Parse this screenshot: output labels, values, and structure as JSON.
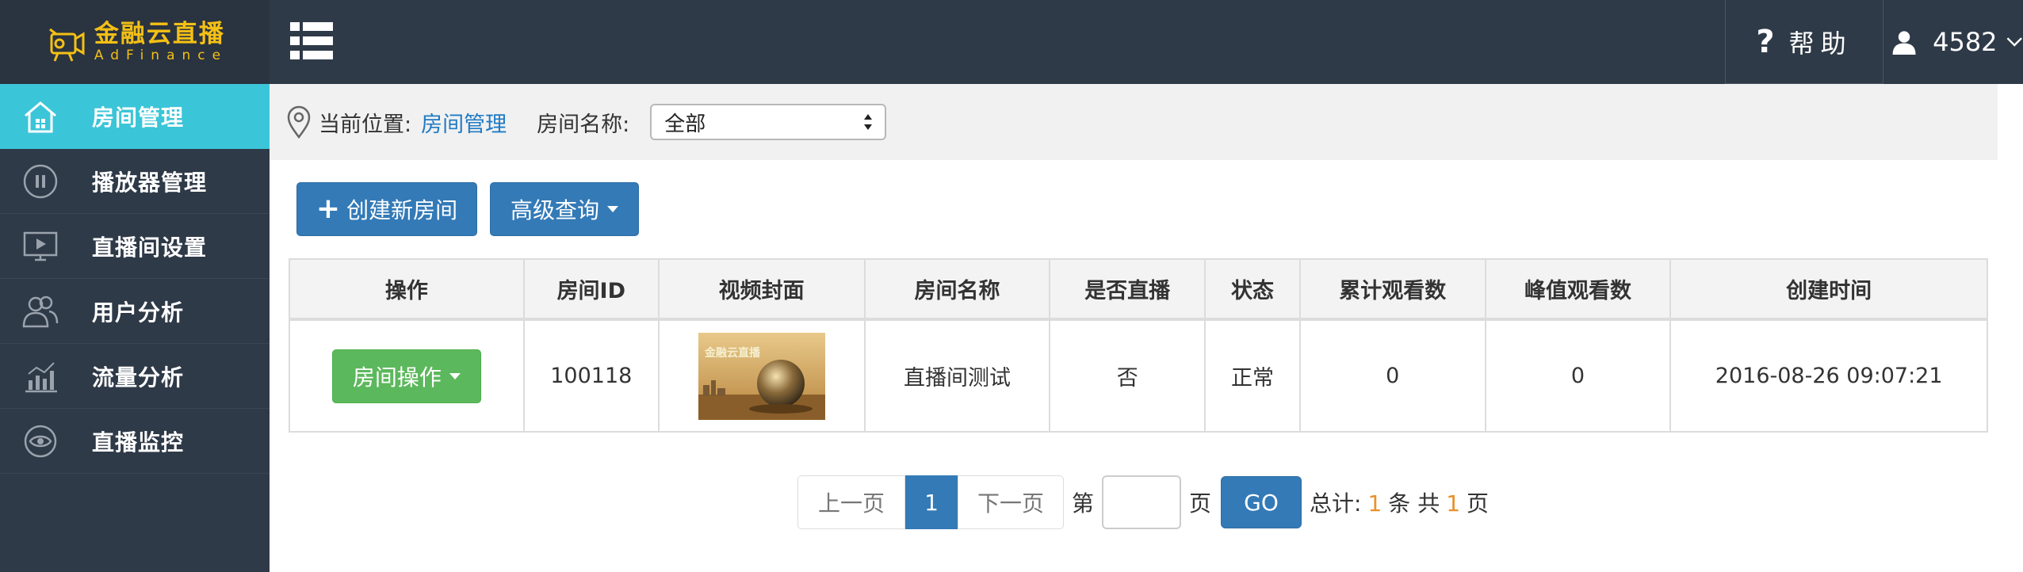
{
  "header": {
    "logo_cn": "金融云直播",
    "logo_en": "AdFinance",
    "help_symbol": "?",
    "help_label": "帮助",
    "user_name": "4582",
    "icons": {
      "menu": "list-menu-icon",
      "user": "user-icon",
      "chevron": "chevron-down-icon"
    }
  },
  "sidebar": {
    "items": [
      {
        "label": "房间管理",
        "icon": "home-icon",
        "active": true
      },
      {
        "label": "播放器管理",
        "icon": "pause-circle-icon",
        "active": false
      },
      {
        "label": "直播间设置",
        "icon": "video-screen-icon",
        "active": false
      },
      {
        "label": "用户分析",
        "icon": "users-icon",
        "active": false
      },
      {
        "label": "流量分析",
        "icon": "bar-chart-icon",
        "active": false
      },
      {
        "label": "直播监控",
        "icon": "monitor-eye-icon",
        "active": false
      }
    ]
  },
  "breadcrumb": {
    "prefix": "当前位置:",
    "current": "房间管理",
    "room_name_label": "房间名称:",
    "room_name_value": "全部"
  },
  "toolbar": {
    "create_label": "创建新房间",
    "advanced_label": "高级查询"
  },
  "table": {
    "headers": [
      "操作",
      "房间ID",
      "视频封面",
      "房间名称",
      "是否直播",
      "状态",
      "累计观看数",
      "峰值观看数",
      "创建时间"
    ],
    "rows": [
      {
        "action_label": "房间操作",
        "room_id": "100118",
        "cover_caption": "金融云直播",
        "room_name": "直播间测试",
        "is_live": "否",
        "status": "正常",
        "total_views": "0",
        "peak_views": "0",
        "created_at": "2016-08-26 09:07:21"
      }
    ]
  },
  "pagination": {
    "prev_label": "上一页",
    "current_page": "1",
    "next_label": "下一页",
    "page_prefix": "第",
    "page_suffix": "页",
    "go_label": "GO",
    "total_prefix": "总计:",
    "total_count": "1",
    "total_mid": "条 共",
    "total_pages": "1",
    "total_suffix": "页"
  },
  "colors": {
    "sidebar_bg": "#2f3a48",
    "active_item": "#3bc5d8",
    "primary": "#337ab7",
    "success": "#5cb85c",
    "logo": "#f4c015",
    "highlight": "#e8912b"
  }
}
